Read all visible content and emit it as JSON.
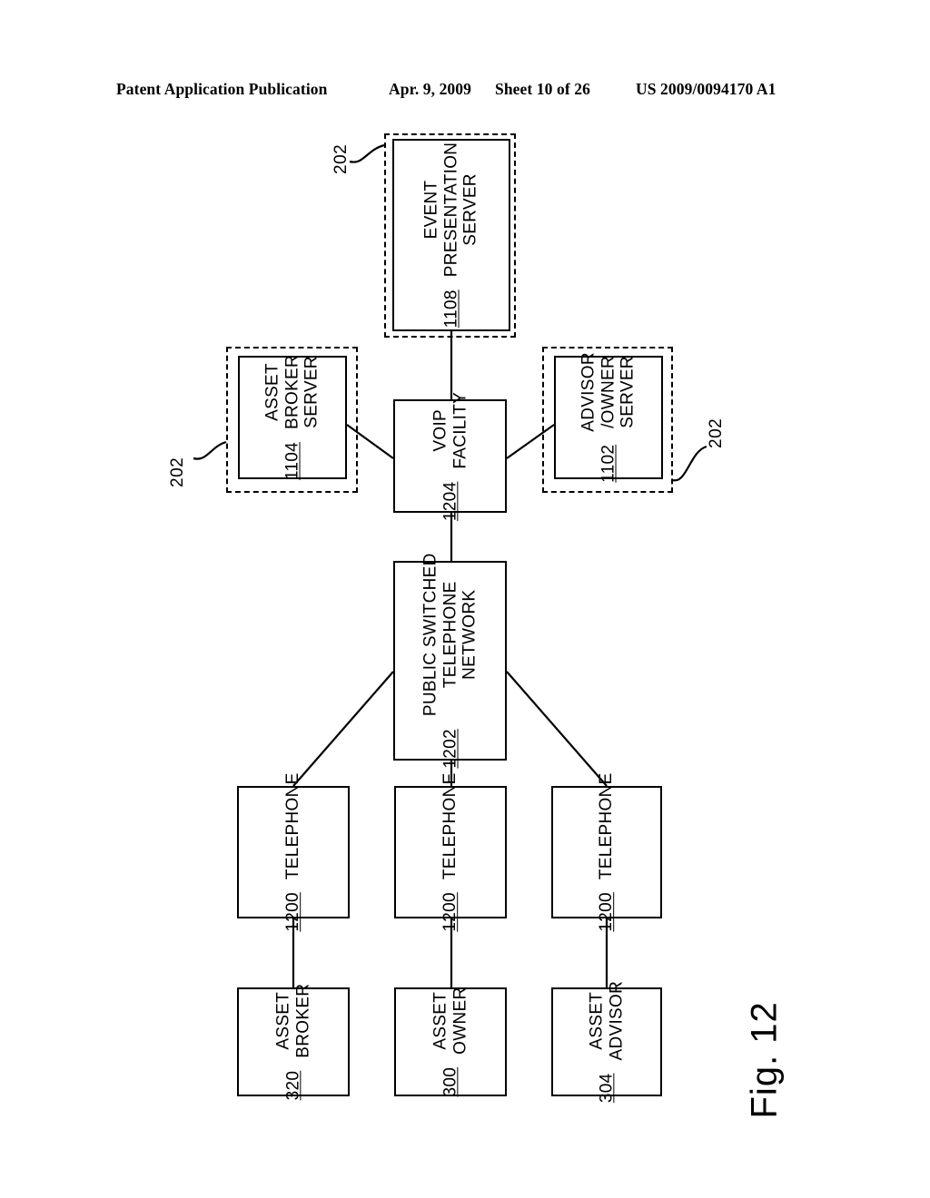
{
  "header": {
    "publication": "Patent Application Publication",
    "date": "Apr. 9, 2009",
    "sheet": "Sheet 10 of 26",
    "patent_number": "US 2009/0094170 A1"
  },
  "figure": {
    "caption": "Fig. 12"
  },
  "callouts": {
    "top": "202",
    "left": "202",
    "right": "202"
  },
  "nodes": {
    "event_presentation_server": {
      "lines": [
        "EVENT",
        "PRESENTATION",
        "SERVER"
      ],
      "ref": "1108"
    },
    "asset_broker_server": {
      "lines": [
        "ASSET",
        "BROKER",
        "SERVER"
      ],
      "ref": "1104"
    },
    "voip_facility": {
      "lines": [
        "VOIP",
        "FACILITY"
      ],
      "ref": "1204"
    },
    "advisor_owner_server": {
      "lines": [
        "ADVISOR",
        "/OWNER",
        "SERVER"
      ],
      "ref": "1102"
    },
    "pstn": {
      "lines": [
        "PUBLIC SWITCHED",
        "TELEPHONE",
        "NETWORK"
      ],
      "ref": "1202"
    },
    "telephone_left": {
      "lines": [
        "TELEPHONE"
      ],
      "ref": "1200"
    },
    "telephone_center": {
      "lines": [
        "TELEPHONE"
      ],
      "ref": "1200"
    },
    "telephone_right": {
      "lines": [
        "TELEPHONE"
      ],
      "ref": "1200"
    },
    "asset_broker": {
      "lines": [
        "ASSET",
        "BROKER"
      ],
      "ref": "320"
    },
    "asset_owner": {
      "lines": [
        "ASSET",
        "OWNER"
      ],
      "ref": "300"
    },
    "asset_advisor": {
      "lines": [
        "ASSET",
        "ADVISOR"
      ],
      "ref": "304"
    }
  },
  "colors": {
    "ink": "#000000",
    "paper": "#ffffff"
  }
}
